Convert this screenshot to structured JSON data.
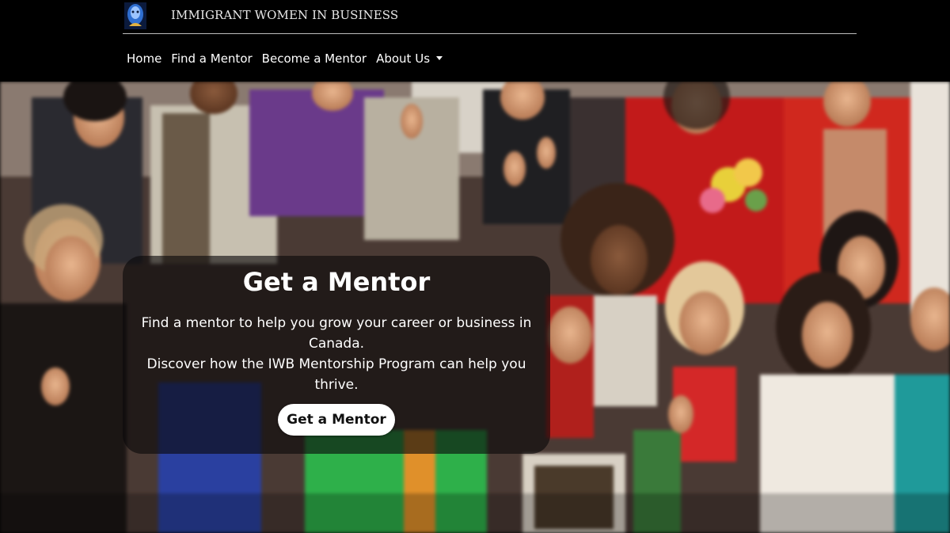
{
  "header": {
    "brand_name": "IMMIGRANT WOMEN IN BUSINESS",
    "logo_icon": "iwb-logo-icon"
  },
  "nav": {
    "items": [
      {
        "label": "Home"
      },
      {
        "label": "Find a Mentor"
      },
      {
        "label": "Become a Mentor"
      },
      {
        "label": "About Us",
        "has_dropdown": true,
        "icon": "caret-down-icon"
      }
    ]
  },
  "hero": {
    "title": "Get a Mentor",
    "line1": "Find a mentor to help you grow your career or business in Canada.",
    "line2": "Discover how the IWB Mentorship Program can help you thrive.",
    "button_label": "Get a Mentor"
  },
  "colors": {
    "header_bg": "#000000",
    "card_bg": "rgba(10,8,10,0.62)",
    "button_bg": "#ffffff",
    "text": "#ffffff"
  }
}
